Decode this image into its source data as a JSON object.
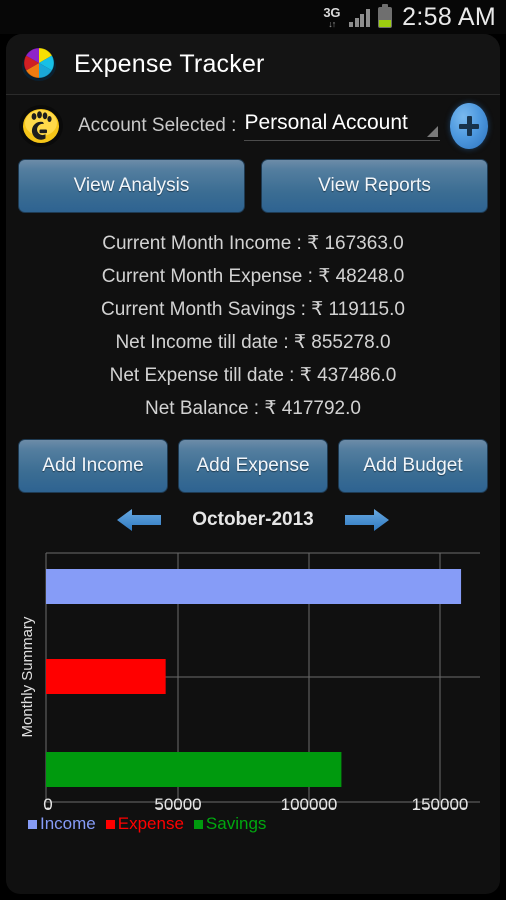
{
  "statusbar": {
    "network_label": "3G",
    "network_arrows": "↓↑",
    "time": "2:58 AM",
    "signal_icon": "signal-bars-icon",
    "battery_icon": "battery-icon"
  },
  "titlebar": {
    "app_title": "Expense Tracker",
    "logo_icon": "pie-chart-logo-icon"
  },
  "account": {
    "avatar_icon": "account-avatar-icon",
    "label": "Account Selected :",
    "selected": "Personal Account",
    "caret_icon": "spinner-caret-icon",
    "add_button_icon": "plus-icon"
  },
  "nav_buttons": {
    "view_analysis": "View Analysis",
    "view_reports": "View Reports"
  },
  "summary": {
    "lines": [
      "Current Month Income : ₹ 167363.0",
      "Current Month Expense : ₹ 48248.0",
      "Current Month Savings : ₹ 119115.0",
      "Net Income till date : ₹ 855278.0",
      "Net Expense till date : ₹ 437486.0",
      "Net Balance : ₹ 417792.0"
    ]
  },
  "add_buttons": {
    "add_income": "Add Income",
    "add_expense": "Add Expense",
    "add_budget": "Add Budget"
  },
  "month_nav": {
    "prev_icon": "arrow-left-icon",
    "next_icon": "arrow-right-icon",
    "current_month": "October-2013"
  },
  "colors": {
    "income": "#869cf7",
    "expense": "#ff0000",
    "savings": "#009a0e",
    "button_blue": "#3b6d93",
    "accent_blue": "#4f9ae0"
  },
  "chart_data": {
    "type": "bar",
    "orientation": "horizontal",
    "title": "",
    "xlabel": "",
    "ylabel": "Monthly  Summary",
    "categories": [
      "Income",
      "Expense",
      "Savings"
    ],
    "series": [
      {
        "name": "Income",
        "values": [
          167363
        ],
        "color": "#869cf7"
      },
      {
        "name": "Expense",
        "values": [
          48248
        ],
        "color": "#ff0000"
      },
      {
        "name": "Savings",
        "values": [
          119115
        ],
        "color": "#009a0e"
      }
    ],
    "values": [
      167363,
      48248,
      119115
    ],
    "xlim": [
      0,
      175000
    ],
    "xticks": [
      0,
      50000,
      100000,
      150000
    ],
    "xticklabels": [
      "0",
      "50000",
      "100000",
      "150000"
    ],
    "grid": true,
    "legend": [
      "Income",
      "Expense",
      "Savings"
    ],
    "legend_position": "bottom-left"
  }
}
